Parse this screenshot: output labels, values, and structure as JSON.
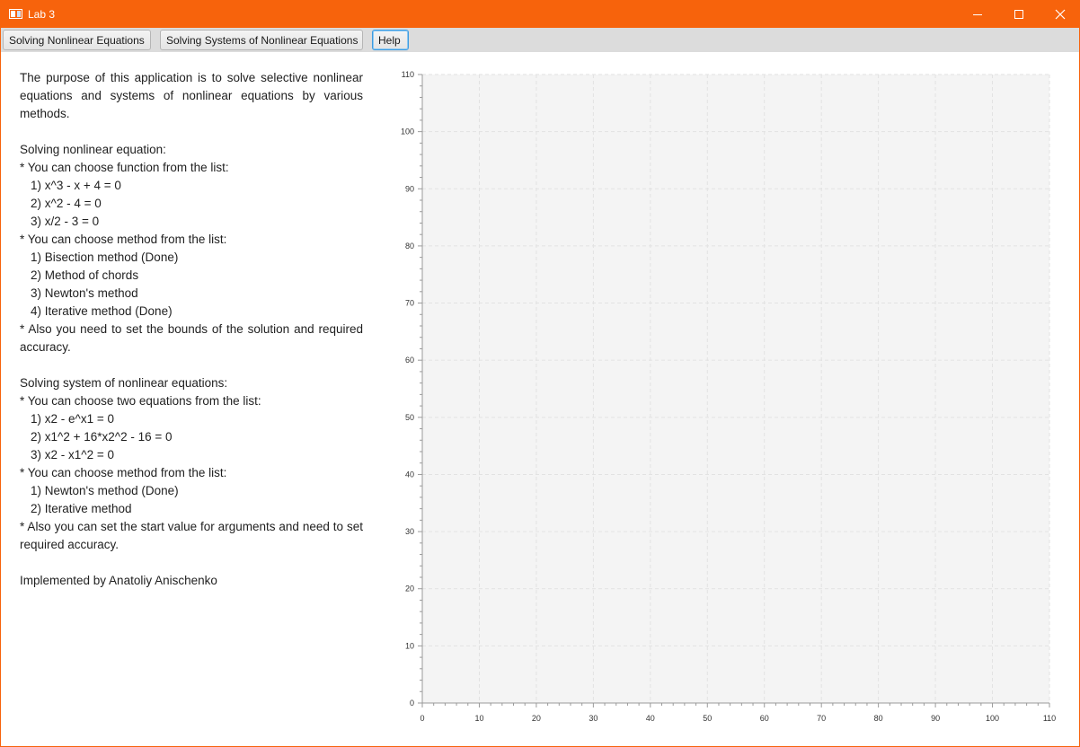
{
  "window": {
    "title": "Lab 3",
    "accent": "#f7630c"
  },
  "tabs": [
    {
      "label": "Solving Nonlinear Equations"
    },
    {
      "label": "Solving Systems of Nonlinear Equations"
    },
    {
      "label": "Help"
    }
  ],
  "help": {
    "intro": "The purpose of this application is to solve selective nonlinear equations and systems of nonlinear equations by various methods.",
    "eq_heading": "Solving nonlinear equation:",
    "eq_func_prompt": "* You can choose function from the list:",
    "eq_funcs": [
      "1) x^3 - x + 4 = 0",
      "2) x^2 - 4 = 0",
      "3) x/2 - 3 = 0"
    ],
    "eq_method_prompt": "* You can choose method from the list:",
    "eq_methods": [
      "1) Bisection method (Done)",
      "2) Method of chords",
      "3) Newton's method",
      "4) Iterative method (Done)"
    ],
    "eq_note": "* Also you need to set the bounds of the solution and required accuracy.",
    "sys_heading": "Solving system of nonlinear equations:",
    "sys_eq_prompt": "* You can choose two equations from the list:",
    "sys_eqs": [
      "1) x2 - e^x1 = 0",
      "2) x1^2 + 16*x2^2 - 16 = 0",
      "3) x2 - x1^2 = 0"
    ],
    "sys_method_prompt": "* You can choose method from the list:",
    "sys_methods": [
      "1) Newton's method (Done)",
      "2) Iterative method"
    ],
    "sys_note": "* Also you can set the start value for arguments and need to set required accuracy.",
    "author": "Implemented by Anatoliy Anischenko"
  },
  "chart_data": {
    "type": "scatter",
    "series": [],
    "xlim": [
      0,
      110
    ],
    "ylim": [
      0,
      110
    ],
    "x_ticks": [
      "0",
      "10",
      "20",
      "30",
      "40",
      "50",
      "60",
      "70",
      "80",
      "90",
      "100",
      "110"
    ],
    "y_ticks": [
      "0",
      "10",
      "20",
      "30",
      "40",
      "50",
      "60",
      "70",
      "80",
      "90",
      "100",
      "110"
    ],
    "grid": true,
    "plot_background": "#f4f4f4",
    "grid_color": "#e2e2e2"
  }
}
